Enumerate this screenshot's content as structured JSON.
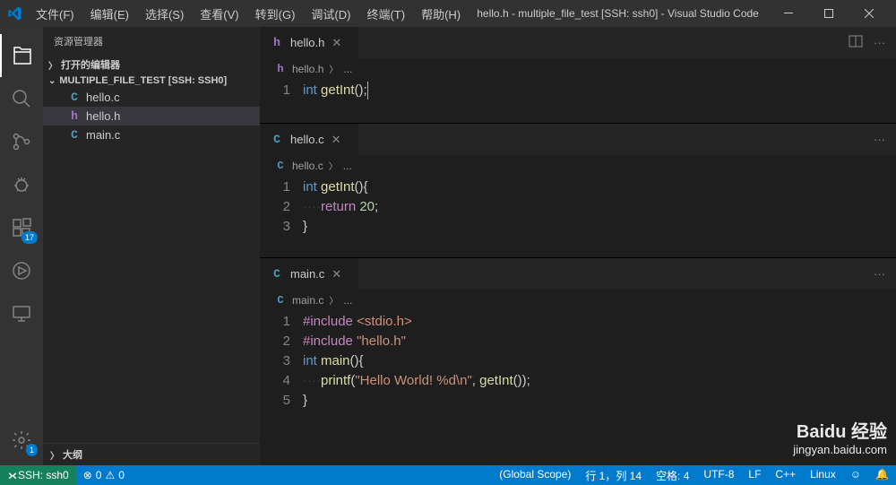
{
  "menu": [
    "文件(F)",
    "编辑(E)",
    "选择(S)",
    "查看(V)",
    "转到(G)",
    "调试(D)",
    "终端(T)",
    "帮助(H)"
  ],
  "window_title": "hello.h - multiple_file_test [SSH: ssh0] - Visual Studio Code",
  "sidebar": {
    "title": "资源管理器",
    "open_editors": "打开的编辑器",
    "folder": "MULTIPLE_FILE_TEST [SSH: SSH0]",
    "files": [
      {
        "icon": "C",
        "name": "hello.c",
        "cls": "c-icon"
      },
      {
        "icon": "h",
        "name": "hello.h",
        "cls": "h-icon"
      },
      {
        "icon": "C",
        "name": "main.c",
        "cls": "c-icon"
      }
    ],
    "outline": "大纲"
  },
  "activity_badges": {
    "extensions": "17",
    "settings": "1"
  },
  "editor1": {
    "tab_icon": "h",
    "tab_name": "hello.h",
    "breadcrumb_file": "hello.h",
    "lines": [
      "1"
    ],
    "code": [
      "<span class='kw'>int</span> <span class='fn'>getInt</span>();<span class='cursor'></span>"
    ]
  },
  "editor2": {
    "tab_icon": "C",
    "tab_name": "hello.c",
    "breadcrumb_file": "hello.c",
    "lines": [
      "1",
      "2",
      "3"
    ],
    "code": [
      "<span class='kw'>int</span> <span class='fn'>getInt</span>(){",
      "<span class='ws-dots'>····</span><span class='ctrl'>return</span> <span class='num'>20</span>;",
      "}"
    ]
  },
  "editor3": {
    "tab_icon": "C",
    "tab_name": "main.c",
    "breadcrumb_file": "main.c",
    "lines": [
      "1",
      "2",
      "3",
      "4",
      "5"
    ],
    "code": [
      "<span class='ctrl'>#include</span> <span class='str'>&lt;stdio.h&gt;</span>",
      "<span class='ctrl'>#include</span> <span class='str'>\"hello.h\"</span>",
      "<span class='kw'>int</span> <span class='fn'>main</span>(){",
      "<span class='ws-dots'>····</span><span class='fn'>printf</span>(<span class='str'>\"Hello World! %d\\n\"</span>, <span class='fn'>getInt</span>());",
      "}"
    ]
  },
  "status": {
    "remote": "SSH: ssh0",
    "errors": "0",
    "warnings": "0",
    "scope": "(Global Scope)",
    "ln_col": "行 1，列 14",
    "spaces": "空格: 4",
    "encoding": "UTF-8",
    "eol": "LF",
    "lang": "C++",
    "os": "Linux"
  },
  "watermark": {
    "main": "Baidu 经验",
    "sub": "jingyan.baidu.com"
  }
}
